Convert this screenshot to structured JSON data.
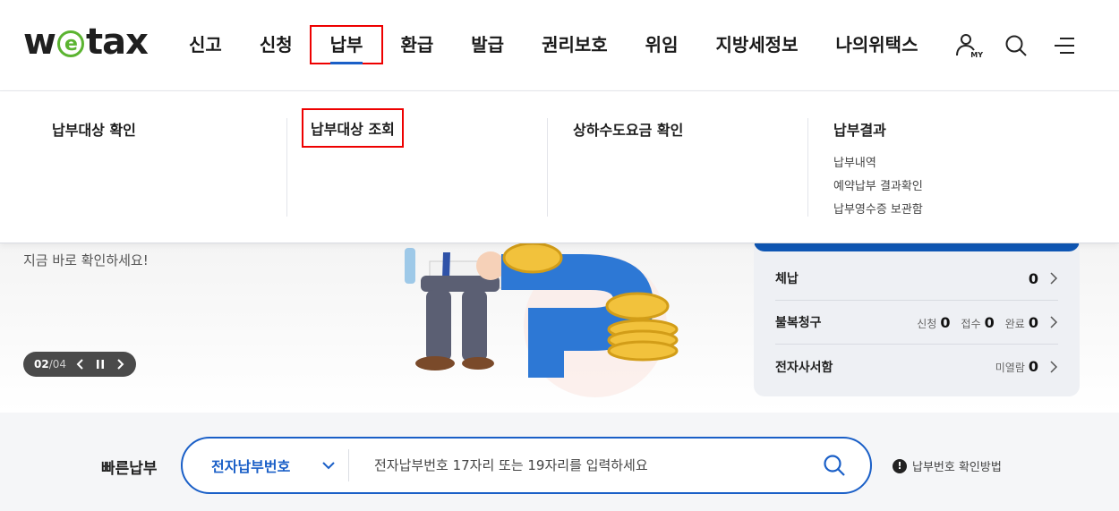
{
  "header": {
    "logo_text_left": "w",
    "logo_text_e": "e",
    "logo_text_right": "tax",
    "nav": [
      {
        "label": "신고",
        "active": false
      },
      {
        "label": "신청",
        "active": false
      },
      {
        "label": "납부",
        "active": true
      },
      {
        "label": "환급",
        "active": false
      },
      {
        "label": "발급",
        "active": false
      },
      {
        "label": "권리보호",
        "active": false
      },
      {
        "label": "위임",
        "active": false
      },
      {
        "label": "지방세정보",
        "active": false
      },
      {
        "label": "나의위택스",
        "active": false
      }
    ],
    "icons": {
      "my": "user-my-icon",
      "my_badge": "MY",
      "search": "search-icon",
      "menu": "hamburger-menu-icon"
    },
    "accent_color": "#1a5fc7"
  },
  "mega_menu": {
    "columns": [
      {
        "title": "납부대상 확인",
        "items": []
      },
      {
        "title": "납부대상 조회",
        "items": []
      },
      {
        "title": "상하수도요금 확인",
        "items": []
      },
      {
        "title": "납부결과",
        "items": [
          "납부내역",
          "예약납부 결과확인",
          "납부영수증 보관함"
        ]
      }
    ]
  },
  "hero": {
    "text": "지금 바로 확인하세요!",
    "pager_current": "02",
    "pager_sep": "/",
    "pager_total": "04"
  },
  "status": {
    "rows": [
      {
        "label": "체납",
        "values": [
          {
            "label": "",
            "count": "0"
          }
        ]
      },
      {
        "label": "불복청구",
        "values": [
          {
            "label": "신청",
            "count": "0"
          },
          {
            "label": "접수",
            "count": "0"
          },
          {
            "label": "완료",
            "count": "0"
          }
        ]
      },
      {
        "label": "전자사서함",
        "values": [
          {
            "label": "미열람",
            "count": "0"
          }
        ]
      }
    ],
    "top_bar_color": "#0f57b4"
  },
  "quick_pay": {
    "label": "빠른납부",
    "select_value": "전자납부번호",
    "input_placeholder": "전자납부번호 17자리 또는 19자리를 입력하세요",
    "help_text": "납부번호 확인방법",
    "help_icon": "!"
  }
}
